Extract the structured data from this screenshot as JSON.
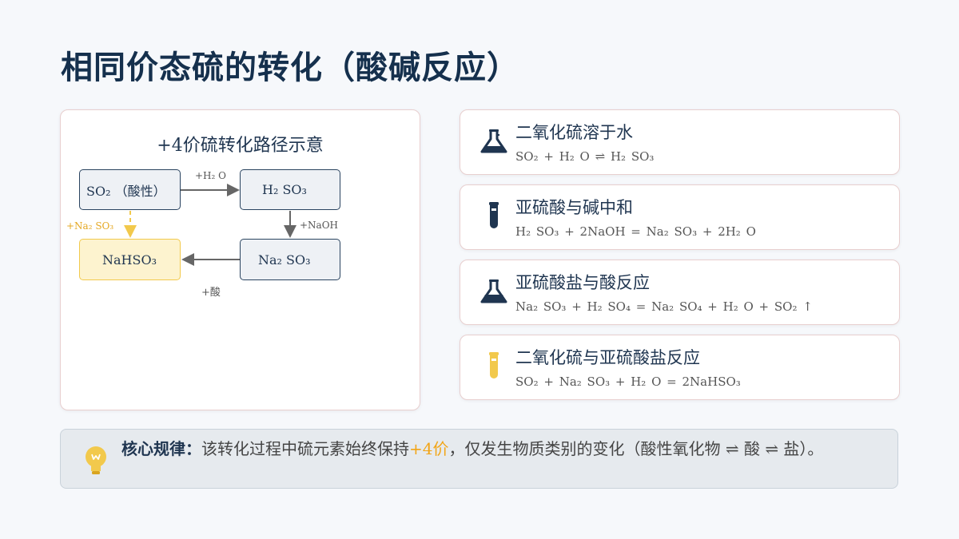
{
  "title": "相同价态硫的转化（酸碱反应）",
  "diagram": {
    "title": "+4价硫转化路径示意",
    "nodes": {
      "so2": "SO₂ （酸性）",
      "h2so3": "H₂ SO₃",
      "nahso3": "NaHSO₃",
      "na2so3": "Na₂ SO₃"
    },
    "edges": {
      "so2_to_h2so3": "+H₂ O",
      "h2so3_to_na2so3": "+NaOH",
      "na2so3_to_nahso3": "+酸",
      "so2_to_nahso3": "+Na₂ SO₃"
    }
  },
  "reactions": [
    {
      "title": "二氧化硫溶于水",
      "equation": "SO₂  + H₂ O ⇌ H₂ SO₃",
      "icon": "flask-icon"
    },
    {
      "title": "亚硫酸与碱中和",
      "equation": "H₂ SO₃  + 2NaOH = Na₂ SO₃  + 2H₂ O",
      "icon": "test-tube-icon"
    },
    {
      "title": "亚硫酸盐与酸反应",
      "equation": "Na₂ SO₃  + H₂ SO₄  = Na₂ SO₄  + H₂ O + SO₂ ↑",
      "icon": "flask-icon"
    },
    {
      "title": "二氧化硫与亚硫酸盐反应",
      "equation": "SO₂  + Na₂ SO₃  + H₂ O = 2NaHSO₃",
      "icon": "test-tube-icon"
    }
  ],
  "summary": {
    "label": "核心规律：",
    "text_before": "该转化过程中硫元素始终保持",
    "highlight": "+4价",
    "text_after": "，仅发生物质类别的变化（酸性氧化物 ⇌ 酸 ⇌ 盐）。",
    "icon": "lightbulb-icon"
  },
  "colors": {
    "title": "#15304d",
    "accent_yellow": "#f2c94c",
    "icon_dark": "#1f3550"
  }
}
